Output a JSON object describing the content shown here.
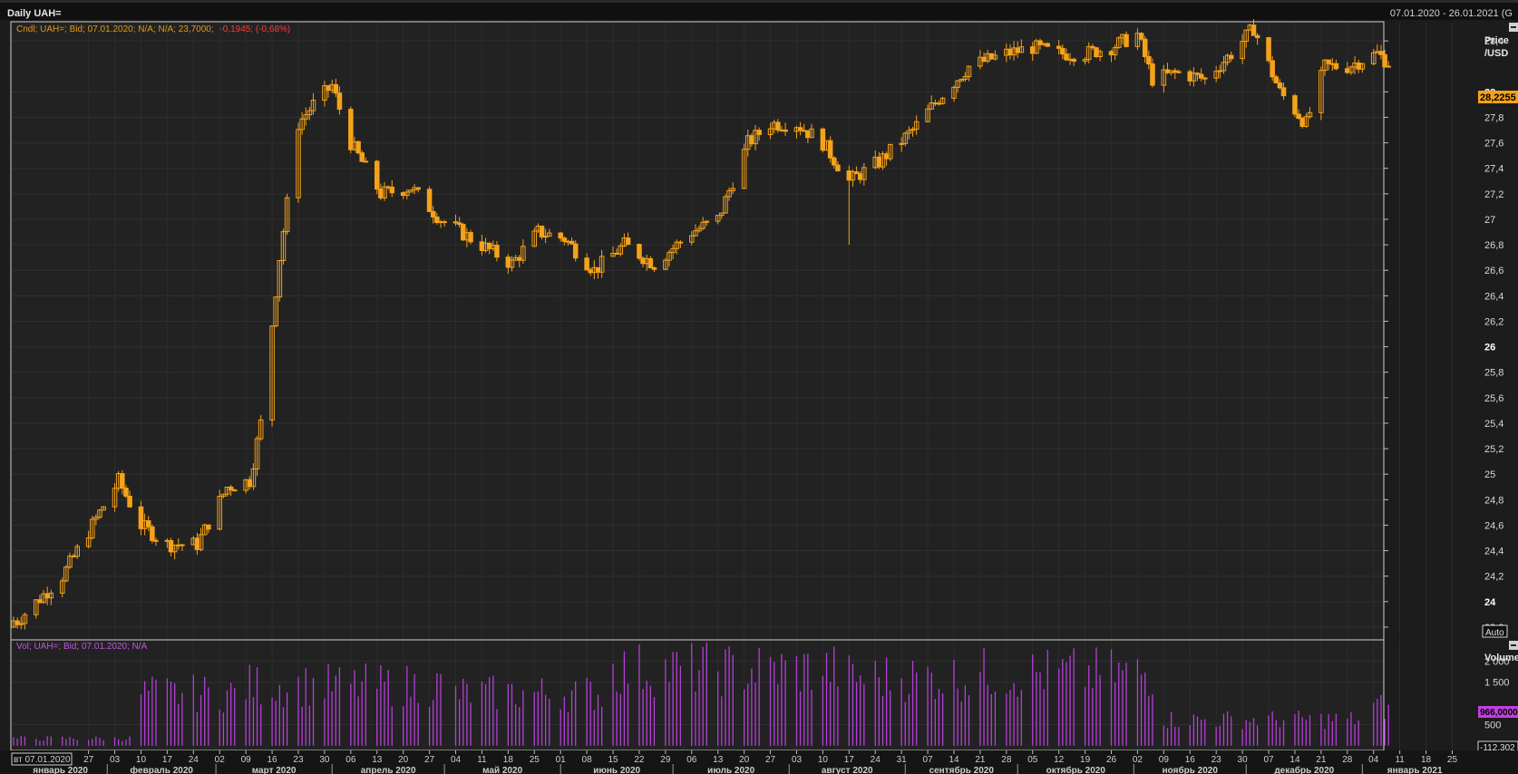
{
  "window": {
    "title": "Daily UAH=",
    "date_range": "07.01.2020 - 26.01.2021 (G"
  },
  "price_panel": {
    "info_prefix": "Cndl; UAH=; Bid; 07.01.2020; N/A; N/A; 23,7000;",
    "info_change": "-0,1945; (-0,68%)",
    "axis_title_1": "Price",
    "axis_title_2": "/USD",
    "last_price_label": "28,2255",
    "auto_label": "Auto",
    "y_ticks": [
      "28,4",
      "28",
      "27,8",
      "27,6",
      "27,4",
      "27,2",
      "27",
      "26,8",
      "26,6",
      "26,4",
      "26,2",
      "26",
      "25,8",
      "25,6",
      "25,4",
      "25,2",
      "25",
      "24,8",
      "24,6",
      "24,4",
      "24,2",
      "24",
      "23,8"
    ],
    "y_ticks_bold": [
      "28",
      "26",
      "24"
    ]
  },
  "volume_panel": {
    "info": "Vol; UAH=; Bid; 07.01.2020; N/A",
    "axis_title": "Volume",
    "y_ticks": [
      "2 000",
      "1 500",
      "500"
    ],
    "last_volume_label": "966,0000",
    "min_label": "-112,302"
  },
  "x_axis": {
    "first_label": "вт 07.01.2020",
    "day_labels": [
      "27",
      "03",
      "10",
      "17",
      "24",
      "02",
      "09",
      "16",
      "23",
      "30",
      "06",
      "13",
      "20",
      "27",
      "04",
      "11",
      "18",
      "25",
      "01",
      "08",
      "15",
      "22",
      "29",
      "06",
      "13",
      "20",
      "27",
      "03",
      "10",
      "17",
      "24",
      "31",
      "07",
      "14",
      "21",
      "28",
      "05",
      "12",
      "19",
      "26",
      "02",
      "09",
      "16",
      "23",
      "30",
      "07",
      "14",
      "21",
      "28",
      "04",
      "11",
      "18",
      "25"
    ],
    "month_labels": [
      "январь 2020",
      "февраль 2020",
      "март 2020",
      "апрель 2020",
      "май 2020",
      "июнь 2020",
      "июль 2020",
      "август 2020",
      "сентябрь 2020",
      "октябрь 2020",
      "ноябрь 2020",
      "декабрь 2020",
      "январь 2021"
    ]
  },
  "colors": {
    "candle": "#f5a21a",
    "volume": "#b43fd8",
    "negative": "#ff3b3b",
    "price_badge": "#f5a21a",
    "volume_badge": "#c040e0"
  },
  "chart_data": [
    {
      "type": "candlestick",
      "ylabel": "Price /USD",
      "ylim": [
        23.7,
        28.55
      ],
      "x_start": "2020-01-07",
      "x_end": "2021-01-26",
      "close_series_approx": [
        {
          "date": "2020-01-08",
          "close": 23.85
        },
        {
          "date": "2020-01-20",
          "close": 24.2
        },
        {
          "date": "2020-01-28",
          "close": 24.6
        },
        {
          "date": "2020-02-04",
          "close": 24.95
        },
        {
          "date": "2020-02-10",
          "close": 24.6
        },
        {
          "date": "2020-02-17",
          "close": 24.45
        },
        {
          "date": "2020-02-25",
          "close": 24.45
        },
        {
          "date": "2020-03-04",
          "close": 24.9
        },
        {
          "date": "2020-03-10",
          "close": 24.95
        },
        {
          "date": "2020-03-13",
          "close": 25.4
        },
        {
          "date": "2020-03-18",
          "close": 26.7
        },
        {
          "date": "2020-03-23",
          "close": 27.75
        },
        {
          "date": "2020-03-27",
          "close": 27.9
        },
        {
          "date": "2020-04-01",
          "close": 28.05
        },
        {
          "date": "2020-04-06",
          "close": 27.6
        },
        {
          "date": "2020-04-14",
          "close": 27.2
        },
        {
          "date": "2020-04-22",
          "close": 27.25
        },
        {
          "date": "2020-04-30",
          "close": 27.0
        },
        {
          "date": "2020-05-08",
          "close": 26.85
        },
        {
          "date": "2020-05-19",
          "close": 26.65
        },
        {
          "date": "2020-05-26",
          "close": 26.9
        },
        {
          "date": "2020-06-02",
          "close": 26.85
        },
        {
          "date": "2020-06-10",
          "close": 26.6
        },
        {
          "date": "2020-06-18",
          "close": 26.8
        },
        {
          "date": "2020-06-26",
          "close": 26.65
        },
        {
          "date": "2020-07-06",
          "close": 26.9
        },
        {
          "date": "2020-07-13",
          "close": 27.0
        },
        {
          "date": "2020-07-21",
          "close": 27.6
        },
        {
          "date": "2020-07-27",
          "close": 27.75
        },
        {
          "date": "2020-08-03",
          "close": 27.75
        },
        {
          "date": "2020-08-10",
          "close": 27.6
        },
        {
          "date": "2020-08-17",
          "close": 27.3
        },
        {
          "date": "2020-08-25",
          "close": 27.45
        },
        {
          "date": "2020-09-03",
          "close": 27.7
        },
        {
          "date": "2020-09-10",
          "close": 27.95
        },
        {
          "date": "2020-09-18",
          "close": 28.2
        },
        {
          "date": "2020-09-28",
          "close": 28.3
        },
        {
          "date": "2020-10-05",
          "close": 28.35
        },
        {
          "date": "2020-10-12",
          "close": 28.3
        },
        {
          "date": "2020-10-19",
          "close": 28.3
        },
        {
          "date": "2020-10-26",
          "close": 28.35
        },
        {
          "date": "2020-11-02",
          "close": 28.45
        },
        {
          "date": "2020-11-06",
          "close": 28.1
        },
        {
          "date": "2020-11-13",
          "close": 28.15
        },
        {
          "date": "2020-11-20",
          "close": 28.1
        },
        {
          "date": "2020-11-27",
          "close": 28.3
        },
        {
          "date": "2020-12-03",
          "close": 28.5
        },
        {
          "date": "2020-12-10",
          "close": 28.0
        },
        {
          "date": "2020-12-17",
          "close": 27.75
        },
        {
          "date": "2020-12-22",
          "close": 28.2
        },
        {
          "date": "2020-12-28",
          "close": 28.2
        },
        {
          "date": "2021-01-05",
          "close": 28.3
        },
        {
          "date": "2021-01-08",
          "close": 28.23
        }
      ],
      "notable_lows": [
        {
          "date": "2020-08-17",
          "low": 26.8
        }
      ],
      "last": 28.2255
    },
    {
      "type": "bar",
      "ylabel": "Volume",
      "ylim": [
        -112.302,
        2500
      ],
      "last": 966.0,
      "volume_levels_approx": [
        {
          "from": "2020-01-07",
          "to": "2020-02-07",
          "value": 180
        },
        {
          "from": "2020-02-10",
          "to": "2020-03-06",
          "value": 1300
        },
        {
          "from": "2020-03-09",
          "to": "2020-04-30",
          "value": 1500
        },
        {
          "from": "2020-05-04",
          "to": "2020-06-12",
          "value": 1300
        },
        {
          "from": "2020-06-15",
          "to": "2020-08-14",
          "value": 1900
        },
        {
          "from": "2020-08-17",
          "to": "2020-09-18",
          "value": 1700
        },
        {
          "from": "2020-09-21",
          "to": "2020-11-06",
          "value": 1800
        },
        {
          "from": "2020-11-09",
          "to": "2020-12-31",
          "value": 650
        },
        {
          "from": "2021-01-04",
          "to": "2021-01-08",
          "value": 966
        }
      ]
    }
  ]
}
